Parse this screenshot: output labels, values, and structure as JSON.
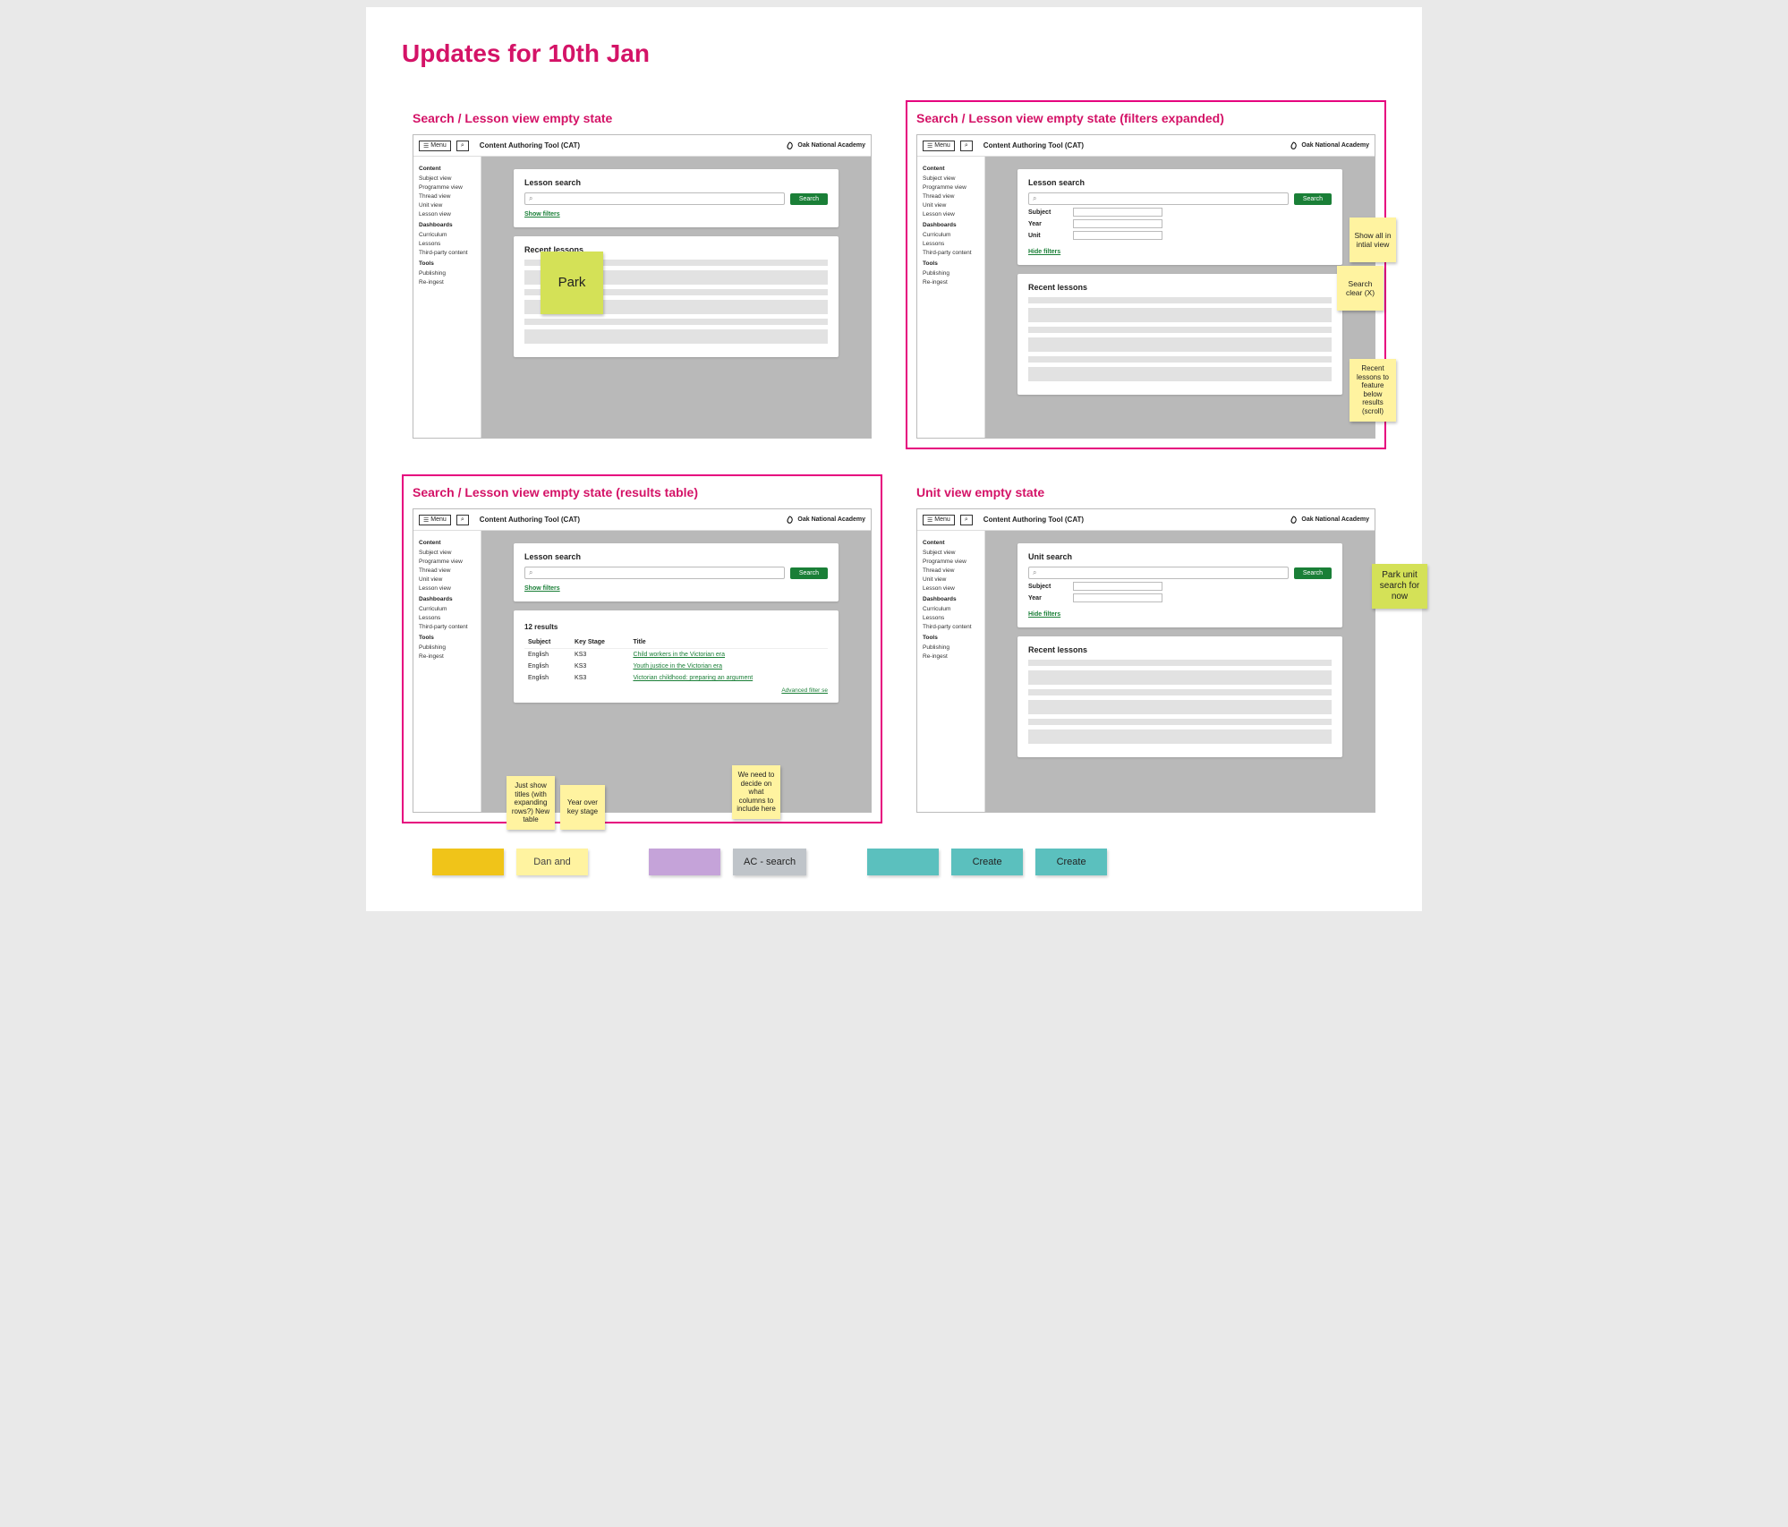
{
  "pageTitle": "Updates for 10th Jan",
  "cells": {
    "a": "Search / Lesson view empty state",
    "b": "Search / Lesson view empty state (filters expanded)",
    "c": "Search / Lesson view empty state (results table)",
    "d": "Unit view empty state"
  },
  "mock": {
    "menu": "Menu",
    "appTitle": "Content Authoring Tool (CAT)",
    "brand": "Oak National Academy",
    "sidebar": {
      "content": {
        "head": "Content",
        "items": [
          "Subject view",
          "Programme view",
          "Thread view",
          "Unit view",
          "Lesson view"
        ]
      },
      "dash": {
        "head": "Dashboards",
        "items": [
          "Curriculum",
          "Lessons",
          "Third-party content"
        ]
      },
      "tools": {
        "head": "Tools",
        "items": [
          "Publishing",
          "Re-ingest"
        ]
      }
    },
    "lessonSearch": "Lesson search",
    "unitSearch": "Unit search",
    "searchBtn": "Search",
    "showFilters": "Show filters",
    "hideFilters": "Hide filters",
    "recent": "Recent lessons",
    "filters": {
      "subject": "Subject",
      "year": "Year",
      "unit": "Unit"
    },
    "resultsCount": "12 results",
    "tbl": {
      "h": {
        "subject": "Subject",
        "ks": "Key Stage",
        "title": "Title"
      },
      "rows": [
        {
          "subject": "English",
          "ks": "KS3",
          "title": "Child workers in the Victorian era"
        },
        {
          "subject": "English",
          "ks": "KS3",
          "title": "Youth justice in the Victorian era"
        },
        {
          "subject": "English",
          "ks": "KS3",
          "title": "Victorian childhood: preparing an argument"
        }
      ],
      "adv": "Advanced filter se"
    }
  },
  "stickies": {
    "park": "Park",
    "showAll": "Show all in intial view",
    "searchClear": "Search clear (X)",
    "recentFeature": "Recent lessons to feature below results (scroll)",
    "justTitles": "Just show titles (with expanding rows?) New table",
    "yearOverKs": "Year over key stage",
    "decideCols": "We need to decide on what columns to include here",
    "parkUnit": "Park unit search for now"
  },
  "chips": {
    "gold": "",
    "dan": "Dan and",
    "purple": "",
    "ac": "AC - search",
    "teal1": "",
    "teal2": "Create",
    "teal3": "Create"
  }
}
